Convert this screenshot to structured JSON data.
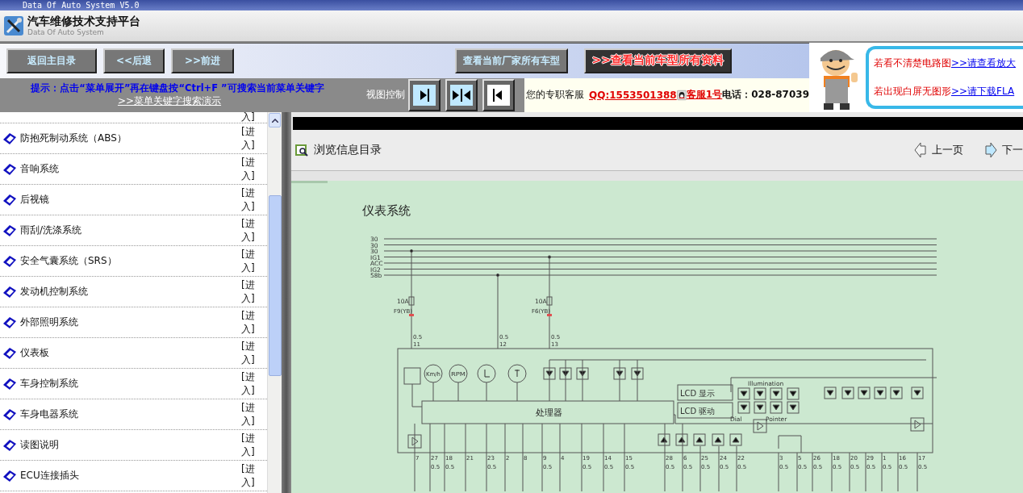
{
  "window": {
    "title": "Data Of Auto System V5.0"
  },
  "header": {
    "title": "汽车维修技术支持平台",
    "subtitle": "Data Of Auto System"
  },
  "nav_buttons": [
    {
      "label": "返回主目录"
    },
    {
      "label": "<<后退"
    },
    {
      "label": ">>前进"
    }
  ],
  "model_buttons": [
    {
      "label": "查看当前厂家所有车型",
      "kind": "plain"
    },
    {
      "label": ">>查看当前车型所有资料",
      "kind": "highlight"
    }
  ],
  "hint": {
    "text": "提示：点击“菜单展开”再在键盘按“Ctrl+F ”可搜索当前菜单关键字",
    "link": ">>菜单关键字搜索演示"
  },
  "view_control": {
    "label": "视图控制",
    "buttons": [
      {
        "kind": "expand-right"
      },
      {
        "kind": "split"
      },
      {
        "kind": "collapse-left"
      }
    ]
  },
  "service": {
    "label": "您的专职客服",
    "qq": "QQ:1553501388",
    "name": "客服1号",
    "phone": "电话：028-87039"
  },
  "ad": {
    "lines": [
      {
        "text": "若看不清楚电路图",
        "link": ">>请查看放大"
      },
      {
        "text": "若出现白屏无图形",
        "link": ">>请下载FLA"
      }
    ]
  },
  "menu": {
    "top_cut_link": "入]",
    "items": [
      {
        "label": "防抱死制动系统（ABS）",
        "link": "[进入]"
      },
      {
        "label": "音响系统",
        "link": "[进入]"
      },
      {
        "label": "后视镜",
        "link": "[进入]"
      },
      {
        "label": "雨刮/洗涤系统",
        "link": "[进入]"
      },
      {
        "label": "安全气囊系统（SRS）",
        "link": "[进入]"
      },
      {
        "label": "发动机控制系统",
        "link": "[进入]"
      },
      {
        "label": "外部照明系统",
        "link": "[进入]"
      },
      {
        "label": "仪表板",
        "link": "[进入]"
      },
      {
        "label": "车身控制系统",
        "link": "[进入]"
      },
      {
        "label": "车身电器系统",
        "link": "[进入]"
      },
      {
        "label": "读图说明",
        "link": "[进入]"
      },
      {
        "label": "ECU连接插头",
        "link": "[进入]"
      }
    ]
  },
  "viewer": {
    "title": "浏览信息目录",
    "prev": "上一页",
    "next": "下一"
  },
  "diagram": {
    "title": "仪表系统",
    "buses": [
      "30",
      "30",
      "30",
      "IG1",
      "ACC",
      "IG2",
      "58b"
    ],
    "feeds": [
      {
        "fuse": "10A",
        "fuse_id": "F9(YB)",
        "wire": "0.5",
        "pin": "11"
      },
      {
        "wire": "0.5",
        "pin": "12"
      },
      {
        "fuse": "10A",
        "fuse_id": "F6(YB)",
        "wire": "0.5",
        "pin": "13"
      }
    ],
    "processor": "处理器",
    "gauges": [
      {
        "kind": "text",
        "label": "Km/h"
      },
      {
        "kind": "text",
        "label": "RPM"
      },
      {
        "kind": "fuel"
      },
      {
        "kind": "temp"
      }
    ],
    "lcd": [
      "LCD 显示",
      "LCD 驱动"
    ],
    "cluster": {
      "title": "Illumination",
      "left": "Dial",
      "right": "Pointer"
    },
    "pins": [
      {
        "num": "7"
      },
      {
        "num": "27",
        "wire": "0.5"
      },
      {
        "num": "18",
        "wire": "0.5"
      },
      {
        "num": "21"
      },
      {
        "num": "23",
        "wire": "0.5"
      },
      {
        "num": "2"
      },
      {
        "num": "8"
      },
      {
        "num": "9",
        "wire": "0.5"
      },
      {
        "num": "4"
      },
      {
        "num": "19",
        "wire": "0.5"
      },
      {
        "num": "14",
        "wire": "0.5"
      },
      {
        "num": "15",
        "wire": "0.5"
      },
      {
        "num": "28",
        "wire": "0.5"
      },
      {
        "num": "6",
        "wire": "0.5"
      },
      {
        "num": "25",
        "wire": "0.5"
      },
      {
        "num": "24",
        "wire": "0.5"
      },
      {
        "num": "22",
        "wire": "0.5"
      },
      {
        "num": "3",
        "wire": "0.5"
      },
      {
        "num": "5",
        "wire": "0.5"
      },
      {
        "num": "26",
        "wire": "0.5"
      },
      {
        "num": "18",
        "wire": "0.5"
      },
      {
        "num": "20",
        "wire": "0.5"
      },
      {
        "num": "29",
        "wire": "0.5"
      },
      {
        "num": "1",
        "wire": "0.5"
      },
      {
        "num": "16",
        "wire": "0.5"
      },
      {
        "num": "17",
        "wire": "0.5"
      }
    ]
  }
}
